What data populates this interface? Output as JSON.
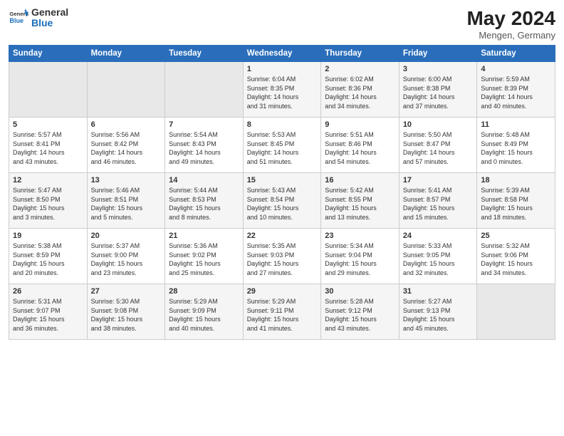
{
  "logo": {
    "line1": "General",
    "line2": "Blue"
  },
  "title": "May 2024",
  "subtitle": "Mengen, Germany",
  "days_header": [
    "Sunday",
    "Monday",
    "Tuesday",
    "Wednesday",
    "Thursday",
    "Friday",
    "Saturday"
  ],
  "weeks": [
    [
      {
        "day": "",
        "info": ""
      },
      {
        "day": "",
        "info": ""
      },
      {
        "day": "",
        "info": ""
      },
      {
        "day": "1",
        "info": "Sunrise: 6:04 AM\nSunset: 8:35 PM\nDaylight: 14 hours\nand 31 minutes."
      },
      {
        "day": "2",
        "info": "Sunrise: 6:02 AM\nSunset: 8:36 PM\nDaylight: 14 hours\nand 34 minutes."
      },
      {
        "day": "3",
        "info": "Sunrise: 6:00 AM\nSunset: 8:38 PM\nDaylight: 14 hours\nand 37 minutes."
      },
      {
        "day": "4",
        "info": "Sunrise: 5:59 AM\nSunset: 8:39 PM\nDaylight: 14 hours\nand 40 minutes."
      }
    ],
    [
      {
        "day": "5",
        "info": "Sunrise: 5:57 AM\nSunset: 8:41 PM\nDaylight: 14 hours\nand 43 minutes."
      },
      {
        "day": "6",
        "info": "Sunrise: 5:56 AM\nSunset: 8:42 PM\nDaylight: 14 hours\nand 46 minutes."
      },
      {
        "day": "7",
        "info": "Sunrise: 5:54 AM\nSunset: 8:43 PM\nDaylight: 14 hours\nand 49 minutes."
      },
      {
        "day": "8",
        "info": "Sunrise: 5:53 AM\nSunset: 8:45 PM\nDaylight: 14 hours\nand 51 minutes."
      },
      {
        "day": "9",
        "info": "Sunrise: 5:51 AM\nSunset: 8:46 PM\nDaylight: 14 hours\nand 54 minutes."
      },
      {
        "day": "10",
        "info": "Sunrise: 5:50 AM\nSunset: 8:47 PM\nDaylight: 14 hours\nand 57 minutes."
      },
      {
        "day": "11",
        "info": "Sunrise: 5:48 AM\nSunset: 8:49 PM\nDaylight: 15 hours\nand 0 minutes."
      }
    ],
    [
      {
        "day": "12",
        "info": "Sunrise: 5:47 AM\nSunset: 8:50 PM\nDaylight: 15 hours\nand 3 minutes."
      },
      {
        "day": "13",
        "info": "Sunrise: 5:46 AM\nSunset: 8:51 PM\nDaylight: 15 hours\nand 5 minutes."
      },
      {
        "day": "14",
        "info": "Sunrise: 5:44 AM\nSunset: 8:53 PM\nDaylight: 15 hours\nand 8 minutes."
      },
      {
        "day": "15",
        "info": "Sunrise: 5:43 AM\nSunset: 8:54 PM\nDaylight: 15 hours\nand 10 minutes."
      },
      {
        "day": "16",
        "info": "Sunrise: 5:42 AM\nSunset: 8:55 PM\nDaylight: 15 hours\nand 13 minutes."
      },
      {
        "day": "17",
        "info": "Sunrise: 5:41 AM\nSunset: 8:57 PM\nDaylight: 15 hours\nand 15 minutes."
      },
      {
        "day": "18",
        "info": "Sunrise: 5:39 AM\nSunset: 8:58 PM\nDaylight: 15 hours\nand 18 minutes."
      }
    ],
    [
      {
        "day": "19",
        "info": "Sunrise: 5:38 AM\nSunset: 8:59 PM\nDaylight: 15 hours\nand 20 minutes."
      },
      {
        "day": "20",
        "info": "Sunrise: 5:37 AM\nSunset: 9:00 PM\nDaylight: 15 hours\nand 23 minutes."
      },
      {
        "day": "21",
        "info": "Sunrise: 5:36 AM\nSunset: 9:02 PM\nDaylight: 15 hours\nand 25 minutes."
      },
      {
        "day": "22",
        "info": "Sunrise: 5:35 AM\nSunset: 9:03 PM\nDaylight: 15 hours\nand 27 minutes."
      },
      {
        "day": "23",
        "info": "Sunrise: 5:34 AM\nSunset: 9:04 PM\nDaylight: 15 hours\nand 29 minutes."
      },
      {
        "day": "24",
        "info": "Sunrise: 5:33 AM\nSunset: 9:05 PM\nDaylight: 15 hours\nand 32 minutes."
      },
      {
        "day": "25",
        "info": "Sunrise: 5:32 AM\nSunset: 9:06 PM\nDaylight: 15 hours\nand 34 minutes."
      }
    ],
    [
      {
        "day": "26",
        "info": "Sunrise: 5:31 AM\nSunset: 9:07 PM\nDaylight: 15 hours\nand 36 minutes."
      },
      {
        "day": "27",
        "info": "Sunrise: 5:30 AM\nSunset: 9:08 PM\nDaylight: 15 hours\nand 38 minutes."
      },
      {
        "day": "28",
        "info": "Sunrise: 5:29 AM\nSunset: 9:09 PM\nDaylight: 15 hours\nand 40 minutes."
      },
      {
        "day": "29",
        "info": "Sunrise: 5:29 AM\nSunset: 9:11 PM\nDaylight: 15 hours\nand 41 minutes."
      },
      {
        "day": "30",
        "info": "Sunrise: 5:28 AM\nSunset: 9:12 PM\nDaylight: 15 hours\nand 43 minutes."
      },
      {
        "day": "31",
        "info": "Sunrise: 5:27 AM\nSunset: 9:13 PM\nDaylight: 15 hours\nand 45 minutes."
      },
      {
        "day": "",
        "info": ""
      }
    ]
  ]
}
